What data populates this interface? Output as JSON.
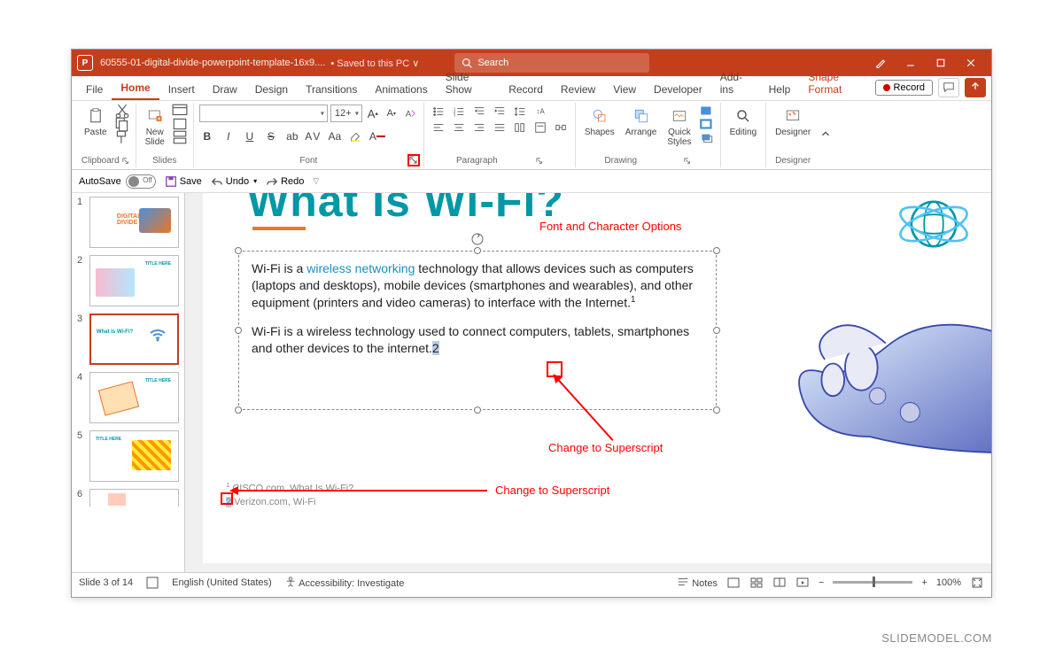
{
  "titlebar": {
    "filename": "60555-01-digital-divide-powerpoint-template-16x9....",
    "saved": "• Saved to this PC ∨",
    "search_placeholder": "Search"
  },
  "tabs": [
    "File",
    "Home",
    "Insert",
    "Draw",
    "Design",
    "Transitions",
    "Animations",
    "Slide Show",
    "Record",
    "Review",
    "View",
    "Developer",
    "Add-ins",
    "Help",
    "Shape Format"
  ],
  "active_tab": "Home",
  "record_btn": "Record",
  "ribbon": {
    "clipboard": {
      "label": "Clipboard",
      "paste": "Paste"
    },
    "slides": {
      "label": "Slides",
      "new": "New\nSlide"
    },
    "font": {
      "label": "Font",
      "size": "12+"
    },
    "paragraph": {
      "label": "Paragraph"
    },
    "drawing": {
      "label": "Drawing",
      "shapes": "Shapes",
      "arrange": "Arrange",
      "quick": "Quick\nStyles"
    },
    "editing": {
      "label": "Editing"
    },
    "designer": {
      "label": "Designer"
    }
  },
  "qat": {
    "autosave": "AutoSave",
    "off": "Off",
    "save": "Save",
    "undo": "Undo",
    "redo": "Redo"
  },
  "thumbs": [
    1,
    2,
    3,
    4,
    5,
    6
  ],
  "current_thumb": 3,
  "slide": {
    "title": "What Is Wi-Fi?",
    "p1a": "Wi-Fi is a ",
    "p1b": "wireless networking",
    "p1c": " technology that allows devices such as computers (laptops and desktops), mobile devices (smartphones and wearables), and other equipment (printers and video cameras) to interface with the Internet.",
    "sup1": "1",
    "p2a": "Wi-Fi is a wireless technology used to connect computers, tablets, smartphones and other devices to the internet.",
    "sup2": "2",
    "fn1_sup": "1",
    "fn1": " CISCO.com, What Is Wi-Fi?",
    "fn2_sup": "2",
    "fn2": " Verizon.com, Wi-Fi"
  },
  "callouts": {
    "c1": "Font and Character Options",
    "c2": "Change to Superscript",
    "c3": "Change to Superscript"
  },
  "statusbar": {
    "slideinfo": "Slide 3 of 14",
    "lang": "English (United States)",
    "acc": "Accessibility: Investigate",
    "notes": "Notes",
    "zoom": "100%"
  },
  "branding": "SLIDEMODEL.COM"
}
